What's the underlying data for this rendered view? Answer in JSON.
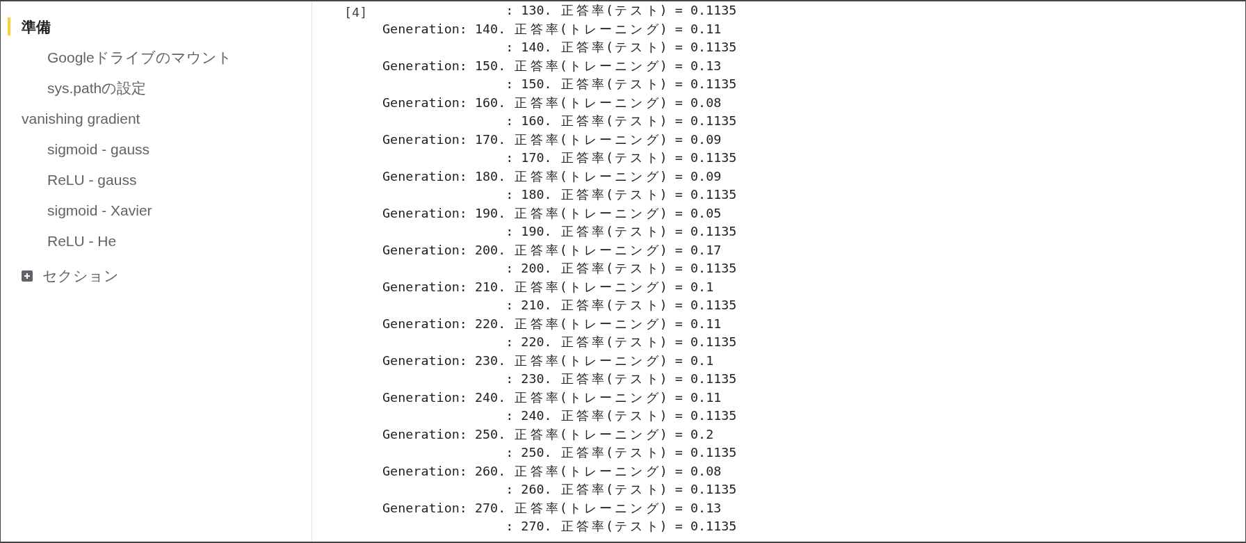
{
  "sidebar": {
    "items": [
      {
        "label": "準備",
        "selected": true,
        "children": [
          {
            "label": "Googleドライブのマウント",
            "selected": false
          },
          {
            "label": "sys.pathの設定",
            "selected": false
          }
        ]
      },
      {
        "label": "vanishing gradient",
        "selected": false,
        "children": [
          {
            "label": "sigmoid - gauss",
            "selected": false
          },
          {
            "label": "ReLU - gauss",
            "selected": false
          },
          {
            "label": "sigmoid - Xavier",
            "selected": false
          },
          {
            "label": "ReLU - He",
            "selected": false
          }
        ]
      }
    ],
    "add_section": {
      "label": "セクション"
    }
  },
  "output": {
    "execution_count": "[4]",
    "lines": [
      {
        "kind": "test",
        "text": ": 130. 正答率(テスト) = 0.1135"
      },
      {
        "kind": "training",
        "text": "Generation: 140. 正答率(トレーニング) = 0.11"
      },
      {
        "kind": "test",
        "text": ": 140. 正答率(テスト) = 0.1135"
      },
      {
        "kind": "training",
        "text": "Generation: 150. 正答率(トレーニング) = 0.13"
      },
      {
        "kind": "test",
        "text": ": 150. 正答率(テスト) = 0.1135"
      },
      {
        "kind": "training",
        "text": "Generation: 160. 正答率(トレーニング) = 0.08"
      },
      {
        "kind": "test",
        "text": ": 160. 正答率(テスト) = 0.1135"
      },
      {
        "kind": "training",
        "text": "Generation: 170. 正答率(トレーニング) = 0.09"
      },
      {
        "kind": "test",
        "text": ": 170. 正答率(テスト) = 0.1135"
      },
      {
        "kind": "training",
        "text": "Generation: 180. 正答率(トレーニング) = 0.09"
      },
      {
        "kind": "test",
        "text": ": 180. 正答率(テスト) = 0.1135"
      },
      {
        "kind": "training",
        "text": "Generation: 190. 正答率(トレーニング) = 0.05"
      },
      {
        "kind": "test",
        "text": ": 190. 正答率(テスト) = 0.1135"
      },
      {
        "kind": "training",
        "text": "Generation: 200. 正答率(トレーニング) = 0.17"
      },
      {
        "kind": "test",
        "text": ": 200. 正答率(テスト) = 0.1135"
      },
      {
        "kind": "training",
        "text": "Generation: 210. 正答率(トレーニング) = 0.1"
      },
      {
        "kind": "test",
        "text": ": 210. 正答率(テスト) = 0.1135"
      },
      {
        "kind": "training",
        "text": "Generation: 220. 正答率(トレーニング) = 0.11"
      },
      {
        "kind": "test",
        "text": ": 220. 正答率(テスト) = 0.1135"
      },
      {
        "kind": "training",
        "text": "Generation: 230. 正答率(トレーニング) = 0.1"
      },
      {
        "kind": "test",
        "text": ": 230. 正答率(テスト) = 0.1135"
      },
      {
        "kind": "training",
        "text": "Generation: 240. 正答率(トレーニング) = 0.11"
      },
      {
        "kind": "test",
        "text": ": 240. 正答率(テスト) = 0.1135"
      },
      {
        "kind": "training",
        "text": "Generation: 250. 正答率(トレーニング) = 0.2"
      },
      {
        "kind": "test",
        "text": ": 250. 正答率(テスト) = 0.1135"
      },
      {
        "kind": "training",
        "text": "Generation: 260. 正答率(トレーニング) = 0.08"
      },
      {
        "kind": "test",
        "text": ": 260. 正答率(テスト) = 0.1135"
      },
      {
        "kind": "training",
        "text": "Generation: 270. 正答率(トレーニング) = 0.13"
      },
      {
        "kind": "test",
        "text": ": 270. 正答率(テスト) = 0.1135"
      }
    ]
  }
}
